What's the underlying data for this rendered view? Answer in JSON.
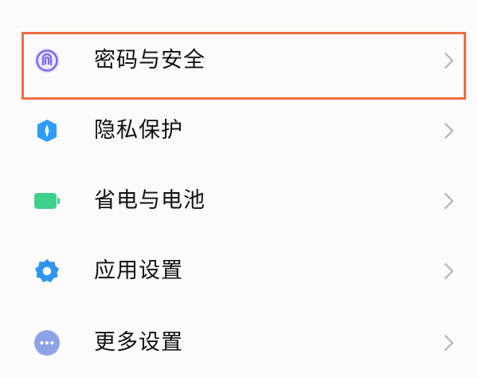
{
  "settings": {
    "items": [
      {
        "label": "密码与安全",
        "icon": "fingerprint-icon",
        "icon_color": "#7b6cf2"
      },
      {
        "label": "隐私保护",
        "icon": "privacy-shield-icon",
        "icon_color": "#2f9df5"
      },
      {
        "label": "省电与电池",
        "icon": "battery-icon",
        "icon_color": "#3ed18c"
      },
      {
        "label": "应用设置",
        "icon": "gear-icon",
        "icon_color": "#2f95f0"
      },
      {
        "label": "更多设置",
        "icon": "more-dots-icon",
        "icon_color": "#8ea3e6"
      }
    ],
    "highlighted_item": "密码与安全"
  },
  "colors": {
    "highlight_border": "#f26a43",
    "chevron": "#b5b5b5",
    "background": "#fbfbfb"
  }
}
